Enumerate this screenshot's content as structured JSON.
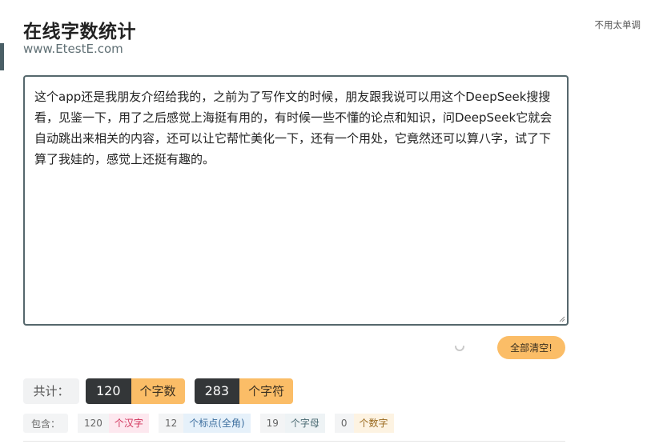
{
  "header": {
    "title": "在线字数统计",
    "site": "www.EtestE.com",
    "top_link": "不用太单调"
  },
  "editor": {
    "text": "这个app还是我朋友介绍给我的，之前为了写作文的时候，朋友跟我说可以用这个DeepSeek搜搜看，见鉴一下，用了之后感觉上海挺有用的，有时候一些不懂的论点和知识，问DeepSeek它就会自动跳出来相关的内容，还可以让它帮忙美化一下，还有一个用处，它竟然还可以算八字，试了下算了我娃的，感觉上还挺有趣的。"
  },
  "actions": {
    "clear_label": "全部清空!"
  },
  "totals": {
    "label": "共计：",
    "chars_count": "120",
    "chars_unit": "个字数",
    "symbols_count": "283",
    "symbols_unit": "个字符"
  },
  "details": {
    "label": "包含：",
    "hanzi_count": "120",
    "hanzi_unit": "个汉字",
    "punct_count": "12",
    "punct_unit": "个标点(全角)",
    "letter_count": "19",
    "letter_unit": "个字母",
    "digit_count": "0",
    "digit_unit": "个数字"
  },
  "colors": {
    "accent": "#fbbd67",
    "dark": "#333638",
    "border": "#56686d"
  }
}
